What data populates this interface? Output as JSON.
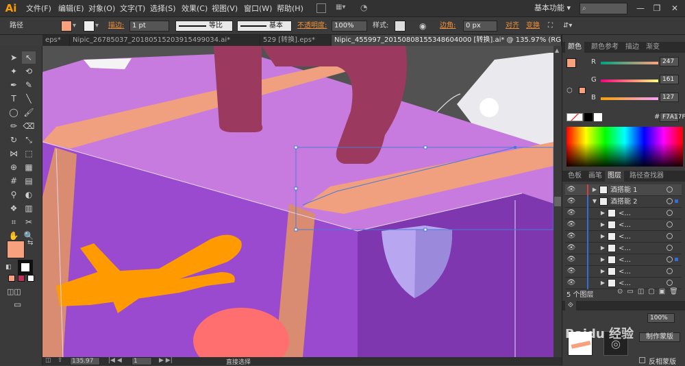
{
  "app": {
    "logo": "Ai"
  },
  "menubar": {
    "items": [
      "文件(F)",
      "编辑(E)",
      "对象(O)",
      "文字(T)",
      "选择(S)",
      "效果(C)",
      "视图(V)",
      "窗口(W)",
      "帮助(H)"
    ],
    "workspace": "基本功能",
    "window_controls": [
      "—",
      "❐",
      "✕"
    ]
  },
  "controlbar": {
    "selection_label": "路径",
    "fill_color": "#F7A17F",
    "stroke_label": "描边:",
    "stroke_weight": "1 pt",
    "profile_label": "等比",
    "brush_label": "基本",
    "opacity_label": "不透明度:",
    "opacity_value": "100%",
    "style_label": "样式:",
    "corner_label": "边角:",
    "corner_value": "0 px",
    "align_label": "对齐",
    "transform_label": "变换"
  },
  "tabs": [
    {
      "label": "eps*",
      "active": false
    },
    {
      "label": "Nipic_26785037_20180515203915499034.ai*",
      "active": false
    },
    {
      "label": "529 [转换].eps*",
      "active": false
    },
    {
      "label": "Nipic_455997_20150808155348604000 [转换].ai* @ 135.97% (RGB/预览)",
      "active": true
    }
  ],
  "color_panel": {
    "tabs": [
      "颜色",
      "颜色参考",
      "描边",
      "渐变"
    ],
    "r_label": "R",
    "r_value": "247",
    "g_label": "G",
    "g_value": "161",
    "b_label": "B",
    "b_value": "127",
    "hex_label": "#",
    "hex_value": "F7A17F"
  },
  "layers_panel": {
    "tabs": [
      "色板",
      "画笔",
      "图层",
      "路径查找器"
    ],
    "rows": [
      {
        "name": "酒搭能 1",
        "indent": 0,
        "expanded": false,
        "selected": false
      },
      {
        "name": "酒搭能 2",
        "indent": 0,
        "expanded": true,
        "selected": true
      },
      {
        "name": "<...",
        "indent": 1,
        "expanded": false,
        "selected": false
      },
      {
        "name": "<...",
        "indent": 1,
        "expanded": false,
        "selected": false
      },
      {
        "name": "<...",
        "indent": 1,
        "expanded": false,
        "selected": false
      },
      {
        "name": "<...",
        "indent": 1,
        "expanded": false,
        "selected": false
      },
      {
        "name": "<...",
        "indent": 1,
        "expanded": false,
        "selected": true
      },
      {
        "name": "<...",
        "indent": 1,
        "expanded": false,
        "selected": false
      },
      {
        "name": "<...",
        "indent": 1,
        "expanded": false,
        "selected": false
      }
    ],
    "footer_count": "5 个图层"
  },
  "transparency_panel": {
    "opacity_value": "100%",
    "make_mask_button": "制作蒙版",
    "invert_mask_label": "反相蒙版"
  },
  "statusbar": {
    "zoom": "135.97",
    "page": "1",
    "tool_label": "直接选择"
  },
  "watermark": "Baidu 经验",
  "colors": {
    "fill": "#F7A17F",
    "suitcase_top": "#C77BDE",
    "suitcase_front": "#9A4ACF",
    "strap": "#F0A07E",
    "handle": "#9B3A5E",
    "airplane": "#FF9A00",
    "selection": "#4A7BD8"
  }
}
